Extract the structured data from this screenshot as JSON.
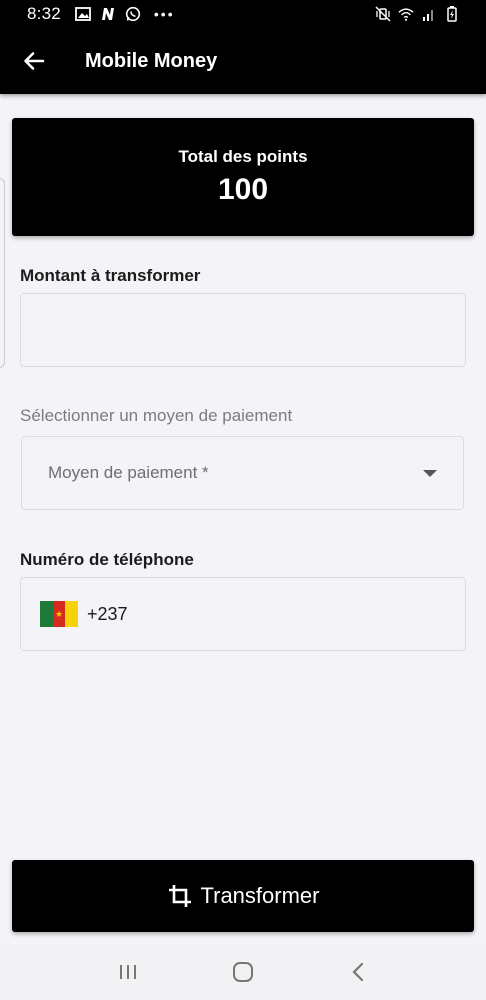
{
  "status_bar": {
    "time": "8:32",
    "left_icons": [
      "image-icon",
      "n-app-icon",
      "whatsapp-icon",
      "more-dots-icon"
    ],
    "right_icons": [
      "mute-vibrate-icon",
      "wifi-icon",
      "signal-icon",
      "battery-icon"
    ]
  },
  "app_bar": {
    "title": "Mobile Money",
    "back_icon": "arrow-left-icon"
  },
  "points": {
    "label": "Total des points",
    "value": "100"
  },
  "amount_field": {
    "label": "Montant à transformer",
    "value": "",
    "placeholder": ""
  },
  "payment": {
    "label": "Sélectionner un moyen de paiement",
    "select_placeholder": "Moyen de paiement *"
  },
  "phone": {
    "label": "Numéro de téléphone",
    "country_code": "+237",
    "flag": "cameroon-flag-icon"
  },
  "action_button": {
    "label": "Transformer",
    "icon": "crop-icon"
  },
  "nav_bar": {
    "icons": [
      "recent-apps-icon",
      "home-icon",
      "back-icon"
    ]
  },
  "colors": {
    "primary": "#000000",
    "background": "#f4f3f7",
    "border": "#dcdce0",
    "muted_text": "#7c7c80"
  }
}
